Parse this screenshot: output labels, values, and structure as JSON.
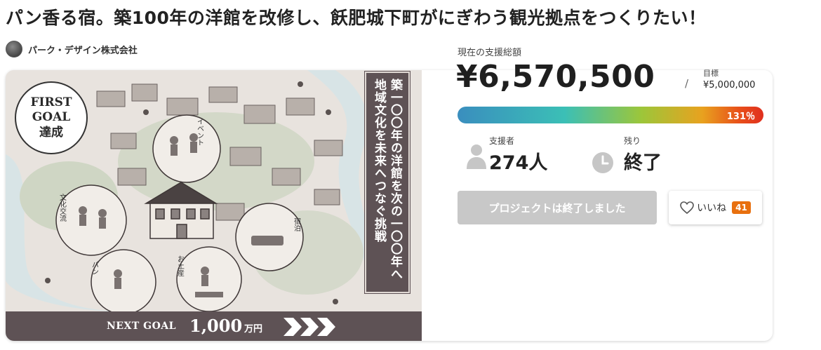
{
  "project": {
    "title": "パン香る宿。築100年の洋館を改修し、飫肥城下町がにぎわう観光拠点をつくりたい！",
    "owner": "パーク・デザイン株式会社"
  },
  "hero": {
    "badge": [
      "FIRST",
      "GOAL",
      "達成"
    ],
    "banner_right": "築一〇〇年の洋館を次の一〇〇年へ",
    "banner_left": "地域文化を未来へつなぐ挑戦",
    "bubble_labels": [
      "イベント",
      "文化交流",
      "宿泊",
      "パン",
      "お土産"
    ],
    "next_goal_label": "NEXT GOAL",
    "next_goal_amount": "1,000",
    "next_goal_unit": "万円"
  },
  "stats": {
    "total_label": "現在の支援総額",
    "total_amount": "¥6,570,500",
    "target_label": "目標",
    "target_slash": "/",
    "target_amount": "¥5,000,000",
    "progress_percent_value": 131,
    "progress_percent_text": "131％",
    "supporters_label": "支援者",
    "supporters_value": "274人",
    "remaining_label": "残り",
    "remaining_value": "終了"
  },
  "actions": {
    "ended_label": "プロジェクトは終了しました",
    "like_label": "いいね",
    "like_count": "41"
  },
  "colors": {
    "banner": "#5e5255",
    "like_badge": "#e8700f",
    "button_disabled": "#c8c8c8"
  },
  "icons": [
    "heart-icon",
    "person-icon",
    "clock-icon",
    "chevron-right-icon"
  ]
}
